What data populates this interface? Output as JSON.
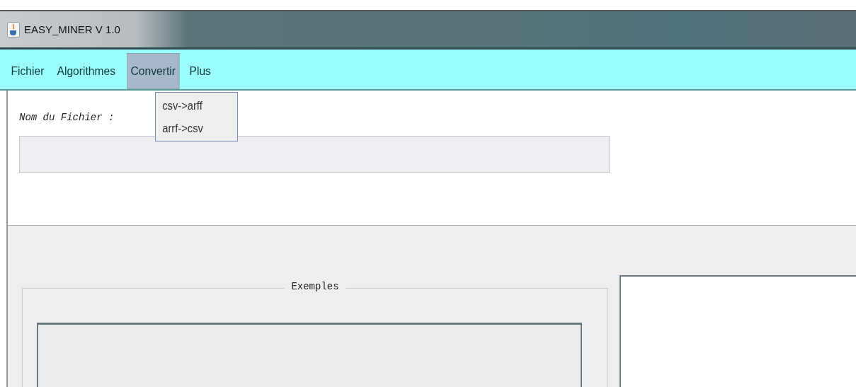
{
  "window": {
    "title": "EASY_MINER V 1.0"
  },
  "menu_bar": [
    {
      "label": "Fichier",
      "selected": false
    },
    {
      "label": "Algorithmes",
      "selected": false
    },
    {
      "label": "Convertir",
      "selected": true
    },
    {
      "label": "Plus",
      "selected": false
    }
  ],
  "dropdown": {
    "items": [
      "csv->arff",
      "arrf->csv"
    ]
  },
  "file_section": {
    "label": "Nom du Fichier :"
  },
  "examples_panel": {
    "title": "Exemples"
  }
}
